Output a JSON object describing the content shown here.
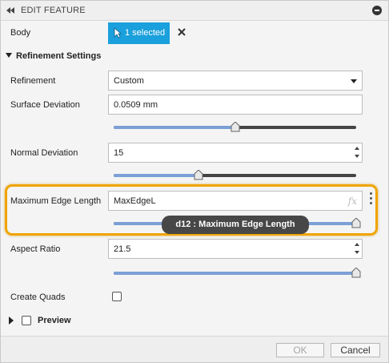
{
  "titlebar": {
    "title": "EDIT FEATURE",
    "collapse_icon": "double-chevron-left-icon",
    "action_icon": "minus-circle-icon"
  },
  "body_row": {
    "label": "Body",
    "selection_label": "1 selected",
    "selection_icon": "cursor-arrow-icon",
    "clear_icon": "close-icon"
  },
  "refinement_settings": {
    "heading": "Refinement Settings",
    "refinement": {
      "label": "Refinement",
      "value": "Custom"
    },
    "surface_deviation": {
      "label": "Surface Deviation",
      "value": "0.0509 mm",
      "slider_fraction": 0.5
    },
    "normal_deviation": {
      "label": "Normal Deviation",
      "value": "15",
      "slider_fraction": 0.35
    },
    "max_edge_length": {
      "label": "Maximum Edge Length",
      "value": "MaxEdgeL",
      "fx": "fx",
      "slider_fraction": 1.0,
      "tooltip": "d12 : Maximum Edge Length"
    },
    "aspect_ratio": {
      "label": "Aspect Ratio",
      "value": "21.5",
      "slider_fraction": 1.0
    },
    "create_quads": {
      "label": "Create Quads",
      "checked": false
    }
  },
  "preview": {
    "label": "Preview",
    "checked": false
  },
  "footer": {
    "ok_label": "OK",
    "cancel_label": "Cancel"
  },
  "colors": {
    "accent": "#1aa0dc",
    "highlight": "#f0a400",
    "slider_fill": "#7ba0d6",
    "slider_track": "#444444"
  }
}
